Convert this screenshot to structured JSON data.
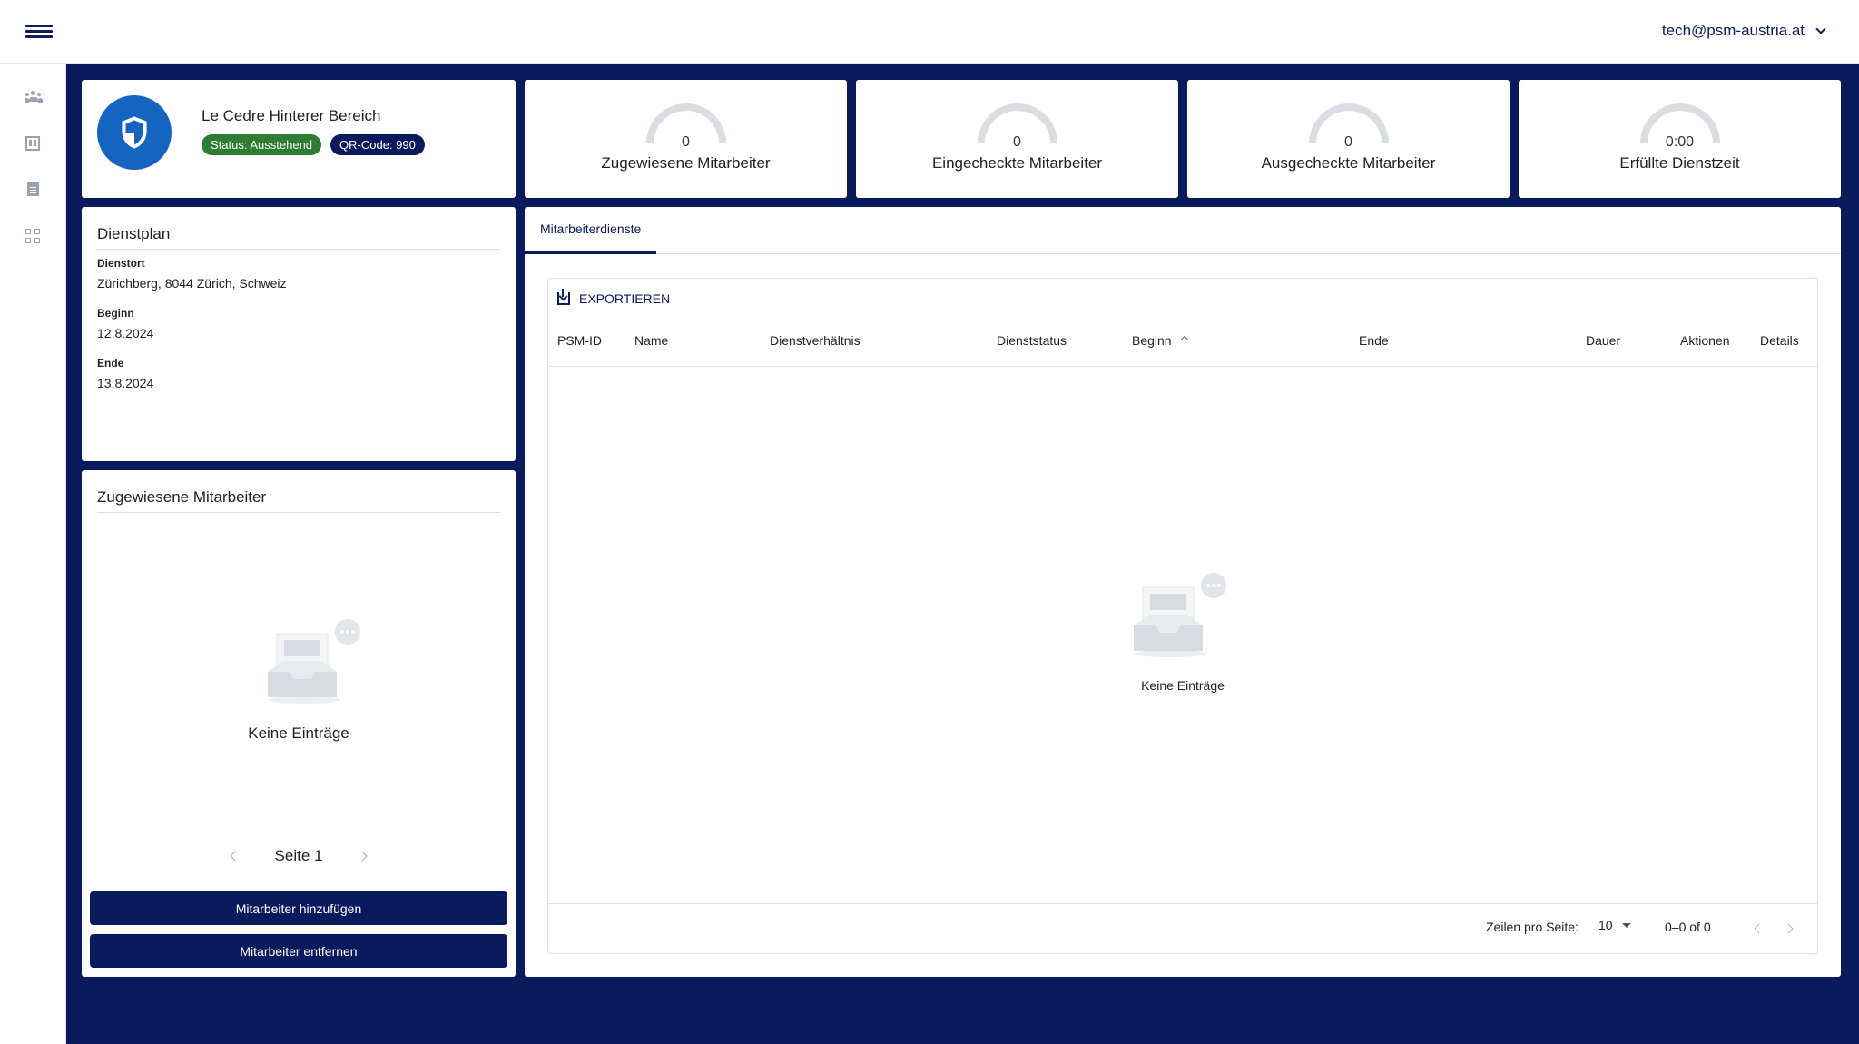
{
  "header": {
    "user_email": "tech@psm-austria.at"
  },
  "site": {
    "title": "Le Cedre Hinterer Bereich",
    "status": "Status: Ausstehend",
    "qr_code": "QR-Code: 990"
  },
  "stats": [
    {
      "value": "0",
      "label": "Zugewiesene Mitarbeiter"
    },
    {
      "value": "0",
      "label": "Eingecheckte Mitarbeiter"
    },
    {
      "value": "0",
      "label": "Ausgecheckte Mitarbeiter"
    },
    {
      "value": "0:00",
      "label": "Erfüllte Dienstzeit"
    }
  ],
  "dienstplan": {
    "title": "Dienstplan",
    "location_label": "Dienstort",
    "location_value": "Zürichberg, 8044 Zürich, Schweiz",
    "start_label": "Beginn",
    "start_value": "12.8.2024",
    "end_label": "Ende",
    "end_value": "13.8.2024"
  },
  "assigned": {
    "title": "Zugewiesene Mitarbeiter",
    "empty_text": "Keine Einträge",
    "page_label": "Seite 1",
    "add_button": "Mitarbeiter hinzufügen",
    "remove_button": "Mitarbeiter entfernen"
  },
  "shifts": {
    "tab_label": "Mitarbeiterdienste",
    "export_label": "EXPORTIEREN",
    "columns": [
      "PSM-ID",
      "Name",
      "Dienstverhältnis",
      "Dienststatus",
      "Beginn",
      "Ende",
      "Dauer",
      "Aktionen",
      "Details"
    ],
    "empty_text": "Keine Einträge",
    "rows_per_page_label": "Zeilen pro Seite:",
    "rows_per_page_value": "10",
    "range_label": "0–0 of 0"
  },
  "colors": {
    "navy": "#0b1a5c",
    "blue": "#1565c0",
    "green": "#2e7d32"
  }
}
